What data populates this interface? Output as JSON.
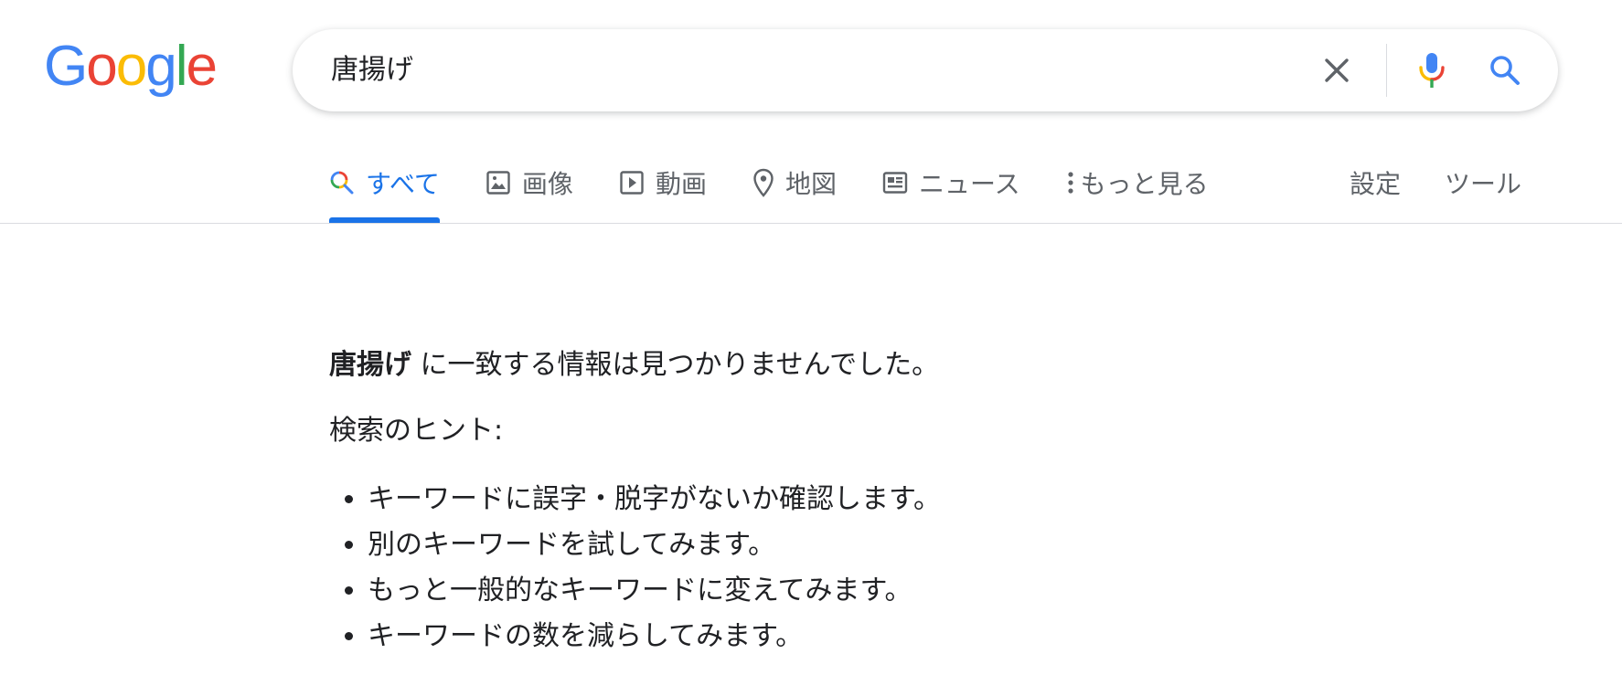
{
  "logo": {
    "text": "Google",
    "letters": [
      "G",
      "o",
      "o",
      "g",
      "l",
      "e"
    ],
    "colors": [
      "#4285F4",
      "#EA4335",
      "#FBBC05",
      "#4285F4",
      "#34A853",
      "#EA4335"
    ]
  },
  "search": {
    "query": "唐揚げ",
    "icons": [
      "close-icon",
      "mic-icon",
      "search-icon"
    ]
  },
  "tabs": [
    {
      "label": "すべて",
      "icon": "search-icon",
      "active": true
    },
    {
      "label": "画像",
      "icon": "image-icon",
      "active": false
    },
    {
      "label": "動画",
      "icon": "video-icon",
      "active": false
    },
    {
      "label": "地図",
      "icon": "map-pin-icon",
      "active": false
    },
    {
      "label": "ニュース",
      "icon": "news-icon",
      "active": false
    },
    {
      "label": "もっと見る",
      "icon": "more-vert-icon",
      "active": false
    }
  ],
  "tools": {
    "settings_label": "設定",
    "tools_label": "ツール"
  },
  "results": {
    "query_bold": "唐揚げ",
    "no_match_text": " に一致する情報は見つかりませんでした。",
    "hint_title": "検索のヒント:",
    "hints": [
      "キーワードに誤字・脱字がないか確認します。",
      "別のキーワードを試してみます。",
      "もっと一般的なキーワードに変えてみます。",
      "キーワードの数を減らしてみます。"
    ]
  },
  "colors": {
    "accent": "#1a73e8",
    "text": "#202124",
    "muted": "#5f6368",
    "divider": "#dadce0"
  }
}
